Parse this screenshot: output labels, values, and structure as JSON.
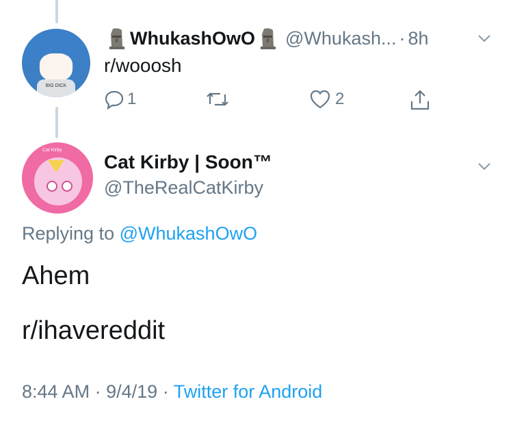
{
  "reply": {
    "avatar_text": "BIG DICK",
    "display_name": "WhukashOwO",
    "handle": "@Whukash...",
    "separator": "·",
    "time": "8h",
    "text": "r/wooosh",
    "reply_count": "1",
    "retweet_count": "",
    "like_count": "2"
  },
  "main": {
    "avatar_text": "Cat Kirby",
    "display_name": "Cat Kirby | Soon™",
    "handle": "@TheRealCatKirby",
    "replying_prefix": "Replying to",
    "replying_handle": "@WhukashOwO",
    "line1": "Ahem",
    "line2": "r/ihavereddit",
    "time": "8:44 AM",
    "dot": "·",
    "date": "9/4/19",
    "source": "Twitter for Android"
  },
  "colors": {
    "link": "#1da1f2",
    "muted": "#657786",
    "text": "#14171a",
    "thread_line": "#ccd6dd"
  },
  "icons": [
    "moai-emoji",
    "chevron-down-icon",
    "reply-icon",
    "retweet-icon",
    "like-icon",
    "share-icon"
  ]
}
